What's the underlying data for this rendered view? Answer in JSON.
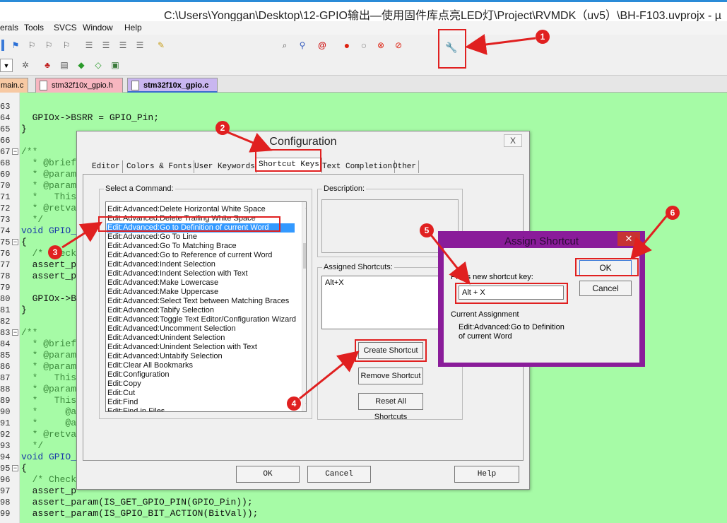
{
  "window": {
    "title": "C:\\Users\\Yonggan\\Desktop\\12-GPIO输出—使用固件库点亮LED灯\\Project\\RVMDK（uv5）\\BH-F103.uvprojx - µ"
  },
  "menu": [
    "erals",
    "Tools",
    "SVCS",
    "Window",
    "Help"
  ],
  "tabs": [
    {
      "label": "main.c",
      "color": "#f7c9a3"
    },
    {
      "label": "stm32f10x_gpio.h",
      "color": "#f7b6c0"
    },
    {
      "label": "stm32f10x_gpio.c",
      "color": "#c9b6f0"
    }
  ],
  "code": {
    "lines": [
      {
        "n": "63",
        "t": ""
      },
      {
        "n": "64",
        "t": "  GPIOx->BSRR = GPIO_Pin;"
      },
      {
        "n": "65",
        "t": "}"
      },
      {
        "n": "66",
        "t": ""
      },
      {
        "n": "67",
        "t": "/**",
        "c": true,
        "fold": true
      },
      {
        "n": "68",
        "t": "  * @brief",
        "c": true
      },
      {
        "n": "69",
        "t": "  * @param",
        "c": true
      },
      {
        "n": "70",
        "t": "  * @param",
        "c": true
      },
      {
        "n": "71",
        "t": "  *   This",
        "c": true
      },
      {
        "n": "72",
        "t": "  * @retva",
        "c": true
      },
      {
        "n": "73",
        "t": "  */",
        "c": true
      },
      {
        "n": "74",
        "t": "void GPIO_",
        "k": true
      },
      {
        "n": "75",
        "t": "{",
        "fold": true
      },
      {
        "n": "76",
        "t": "  /* Check",
        "c": true
      },
      {
        "n": "77",
        "t": "  assert_p"
      },
      {
        "n": "78",
        "t": "  assert_p"
      },
      {
        "n": "79",
        "t": ""
      },
      {
        "n": "80",
        "t": "  GPIOx->B"
      },
      {
        "n": "81",
        "t": "}"
      },
      {
        "n": "82",
        "t": ""
      },
      {
        "n": "83",
        "t": "/**",
        "c": true,
        "fold": true
      },
      {
        "n": "84",
        "t": "  * @brief",
        "c": true
      },
      {
        "n": "85",
        "t": "  * @param",
        "c": true
      },
      {
        "n": "86",
        "t": "  * @param",
        "c": true
      },
      {
        "n": "87",
        "t": "  *   This",
        "c": true
      },
      {
        "n": "88",
        "t": "  * @param",
        "c": true
      },
      {
        "n": "89",
        "t": "  *   This",
        "c": true
      },
      {
        "n": "90",
        "t": "  *     @a",
        "c": true
      },
      {
        "n": "91",
        "t": "  *     @a",
        "c": true
      },
      {
        "n": "92",
        "t": "  * @retva",
        "c": true
      },
      {
        "n": "93",
        "t": "  */",
        "c": true
      },
      {
        "n": "94",
        "t": "void GPIO_",
        "k": true
      },
      {
        "n": "95",
        "t": "{",
        "fold": true
      },
      {
        "n": "96",
        "t": "  /* Check",
        "c": true
      },
      {
        "n": "97",
        "t": "  assert_p"
      },
      {
        "n": "98",
        "t": "  assert_param(IS_GET_GPIO_PIN(GPIO_Pin));"
      },
      {
        "n": "99",
        "t": "  assert_param(IS_GPIO_BIT_ACTION(BitVal));"
      }
    ]
  },
  "config": {
    "title": "Configuration",
    "tabs": [
      "Editor",
      "Colors & Fonts",
      "User Keywords",
      "Shortcut Keys",
      "Text Completion",
      "Other"
    ],
    "select_label": "Select a Command:",
    "description_label": "Description:",
    "assigned_label": "Assigned Shortcuts:",
    "assigned_value": "Alt+X",
    "commands": [
      "Edit:Advanced:Delete Horizontal White Space",
      "Edit:Advanced:Delete Trailing White Space",
      "Edit:Advanced:Go to Definition of current Word",
      "Edit:Advanced:Go To Line",
      "Edit:Advanced:Go To Matching Brace",
      "Edit:Advanced:Go to Reference of current Word",
      "Edit:Advanced:Indent Selection",
      "Edit:Advanced:Indent Selection with Text",
      "Edit:Advanced:Make Lowercase",
      "Edit:Advanced:Make Uppercase",
      "Edit:Advanced:Select Text between Matching Braces",
      "Edit:Advanced:Tabify Selection",
      "Edit:Advanced:Toggle Text Editor/Configuration Wizard",
      "Edit:Advanced:Uncomment Selection",
      "Edit:Advanced:Unindent Selection",
      "Edit:Advanced:Unindent Selection with Text",
      "Edit:Advanced:Untabify Selection",
      "Edit:Clear All Bookmarks",
      "Edit:Configuration",
      "Edit:Copy",
      "Edit:Cut",
      "Edit:Find",
      "Edit:Find in Files"
    ],
    "create_btn": "Create Shortcut",
    "remove_btn": "Remove Shortcut",
    "reset_btn": "Reset All Shortcuts",
    "ok": "OK",
    "cancel": "Cancel",
    "help": "Help",
    "close": "X"
  },
  "assign": {
    "title": "Assign Shortcut",
    "press_label": "Press new shortcut key:",
    "key_value": "Alt + X",
    "current_label": "Current Assignment",
    "current_value_1": "Edit:Advanced:Go to Definition",
    "current_value_2": "of current Word",
    "ok": "OK",
    "cancel": "Cancel",
    "close": "✕"
  },
  "annotations": [
    "1",
    "2",
    "3",
    "4",
    "5",
    "6"
  ]
}
